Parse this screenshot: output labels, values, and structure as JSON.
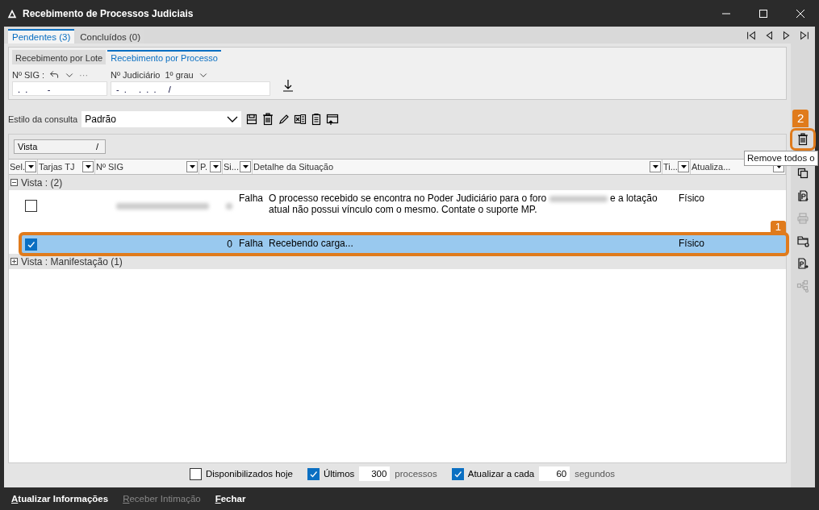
{
  "window": {
    "title": "Recebimento de Processos Judiciais"
  },
  "tabs": [
    {
      "label": "Pendentes (3)",
      "selected": true
    },
    {
      "label": "Concluídos (0)",
      "selected": false
    }
  ],
  "subtabs": [
    {
      "label": "Recebimento por Lote",
      "selected": false
    },
    {
      "label": "Recebimento por Processo",
      "selected": true
    }
  ],
  "fields": {
    "sig_label": "Nº SIG :",
    "more": "···",
    "sig_value": ".  .        -",
    "judicial_label": "Nº Judiciário",
    "degree": "1º grau",
    "judicial_value": "-  .     .  .  .     /"
  },
  "query_style": {
    "label": "Estilo da consulta",
    "value": "Padrão"
  },
  "grid": {
    "group_chip": "Vista",
    "group_chip_sort": "/",
    "columns": [
      "Sel.",
      "Tarjas TJ",
      "Nº SIG",
      "P.",
      "Si...",
      "Detalhe da Situação",
      "Ti...",
      "Atualiza..."
    ],
    "groups": [
      {
        "label": "Vista :  (2)",
        "expanded": true,
        "rows": [
          {
            "checked": false,
            "selected": false,
            "redacted": true,
            "p": "",
            "situacao": "Falha",
            "detalhe_before": "O processo recebido se encontra no Poder Judiciário para o foro",
            "detalhe_after": "e a lotação atual não possui vínculo com o mesmo. Contate o suporte MP.",
            "tipo": "Físico"
          },
          {
            "checked": true,
            "selected": true,
            "redacted": false,
            "p": "0",
            "situacao": "Falha",
            "detalhe_before": "Recebendo carga...",
            "detalhe_after": "",
            "tipo": "Físico",
            "callout": "1"
          }
        ]
      },
      {
        "label": "Vista : Manifestação (1)",
        "expanded": false
      }
    ]
  },
  "options": [
    {
      "kind": "check",
      "label": "Disponibilizados hoje",
      "checked": false
    },
    {
      "kind": "check",
      "label": "Últimos",
      "checked": true
    },
    {
      "kind": "input",
      "value": "300"
    },
    {
      "kind": "text",
      "label": "processos"
    },
    {
      "kind": "check",
      "label": "Atualizar a cada",
      "checked": true
    },
    {
      "kind": "input",
      "value": "60"
    },
    {
      "kind": "text",
      "label": "segundos"
    }
  ],
  "side_tools": [
    {
      "disabled": false,
      "callout": "2",
      "tooltip": "Remove todos o"
    },
    {
      "disabled": false
    },
    {
      "disabled": false
    },
    {
      "disabled": true
    },
    {
      "disabled": false
    },
    {
      "disabled": false
    },
    {
      "disabled": true
    }
  ],
  "actions": [
    {
      "label": "Atualizar Informações",
      "disabled": false
    },
    {
      "label": "Receber Intimação",
      "disabled": true
    },
    {
      "label": "Fechar",
      "disabled": false
    }
  ]
}
